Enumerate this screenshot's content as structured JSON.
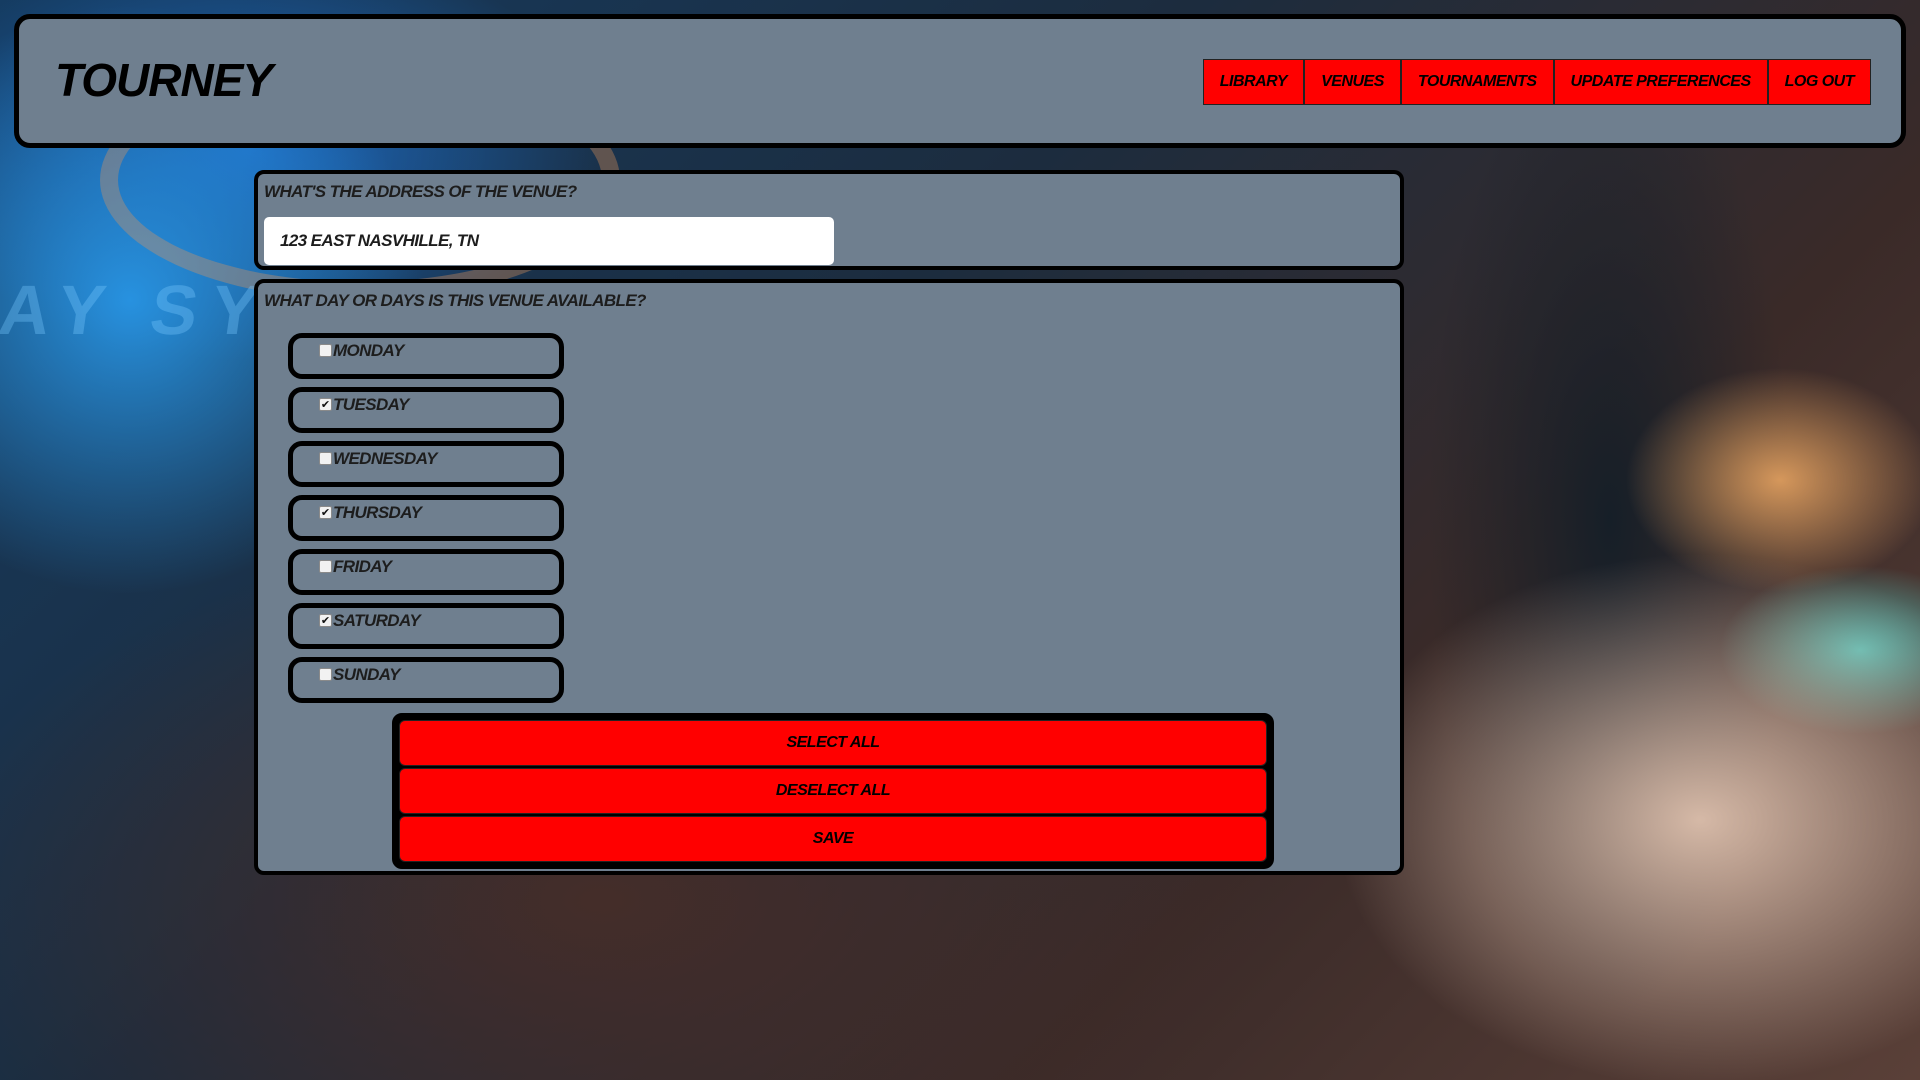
{
  "app": {
    "logo": "TOURNEY"
  },
  "nav": [
    {
      "label": "LIBRARY"
    },
    {
      "label": "VENUES"
    },
    {
      "label": "TOURNAMENTS"
    },
    {
      "label": "UPDATE PREFERENCES"
    },
    {
      "label": "LOG OUT"
    }
  ],
  "address_section": {
    "question": "What's the address of the venue?",
    "value": "123 East Nasvhille, TN"
  },
  "days_section": {
    "question": "What day or days is this venue available?",
    "days": [
      {
        "label": "Monday",
        "checked": false
      },
      {
        "label": "Tuesday",
        "checked": true
      },
      {
        "label": "Wednesday",
        "checked": false
      },
      {
        "label": "Thursday",
        "checked": true
      },
      {
        "label": "Friday",
        "checked": false
      },
      {
        "label": "Saturday",
        "checked": true
      },
      {
        "label": "Sunday",
        "checked": false
      }
    ]
  },
  "actions": {
    "select_all": "Select All",
    "deselect_all": "Deselect All",
    "save": "Save"
  },
  "colors": {
    "panel": "#6f7f8f",
    "button": "#ff0000",
    "border": "#000000"
  }
}
